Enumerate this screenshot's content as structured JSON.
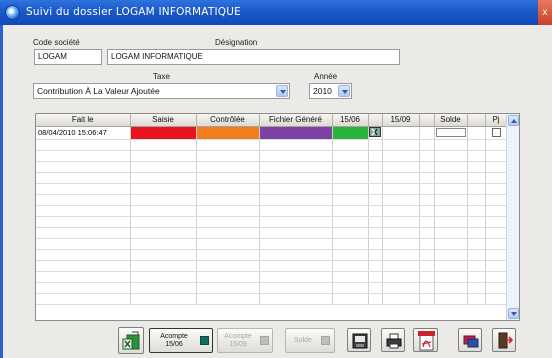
{
  "window": {
    "title": "Suivi du dossier LOGAM INFORMATIQUE",
    "close": "x"
  },
  "form": {
    "code_label": "Code société",
    "code_value": "LOGAM",
    "designation_label": "Désignation",
    "designation_value": "LOGAM INFORMATIQUE",
    "taxe_label": "Taxe",
    "taxe_value": "Contribution À La Valeur Ajoutée",
    "annee_label": "Année",
    "annee_value": "2010"
  },
  "grid": {
    "columns": [
      "Fait le",
      "Saisie",
      "Contrôlée",
      "Fichier Généré",
      "15/06",
      "",
      "15/09",
      "",
      "Solde",
      "",
      "Pj"
    ],
    "rows": [
      {
        "fait_le": "08/04/2010 15:06:47"
      }
    ],
    "colors": {
      "saisie": "#e8141e",
      "controlee": "#f07e1e",
      "fichier": "#7d42a4",
      "acompte1": "#28b43c"
    }
  },
  "toolbar": {
    "acompte1": "Acompte\n15/06",
    "acompte2": "Acompte\n15/09",
    "solde": "Solde",
    "icons": [
      "excel-export-icon",
      "save-icon",
      "print-icon",
      "pdf-icon",
      "mail-icon",
      "exit-icon"
    ]
  }
}
